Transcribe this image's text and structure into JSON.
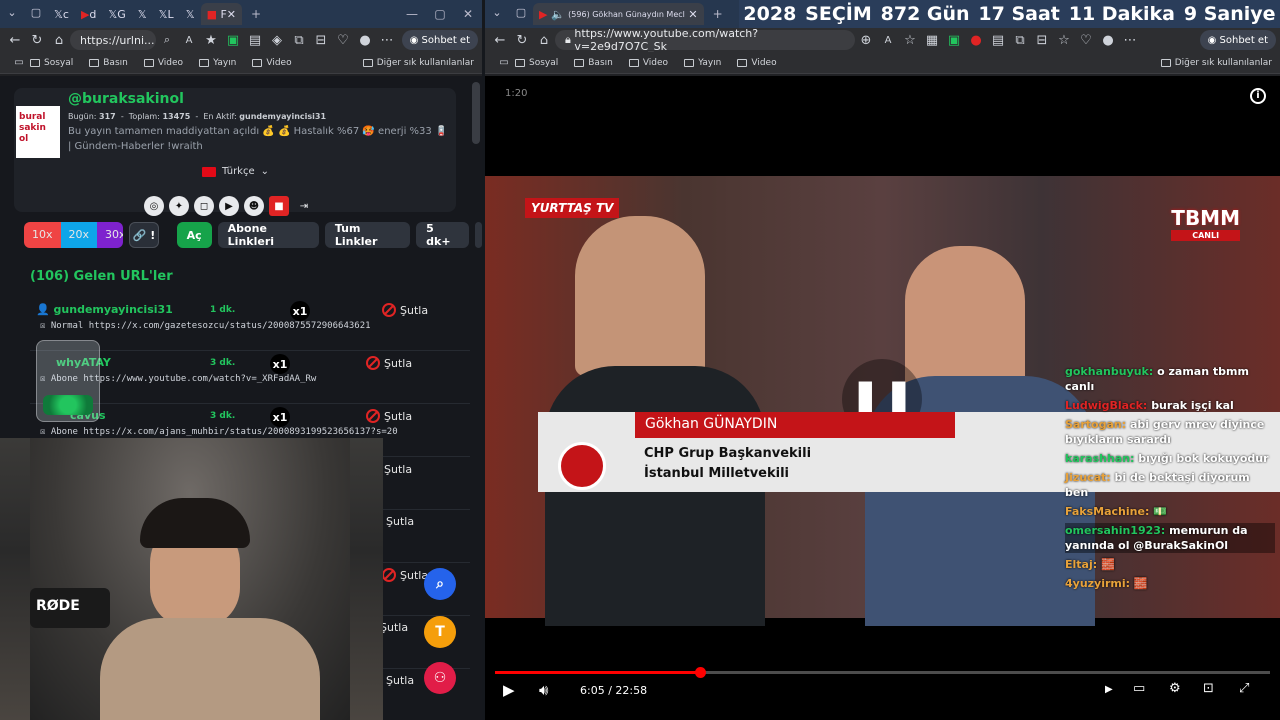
{
  "left_window": {
    "tabs": [
      "c",
      "d",
      "G",
      "L",
      "F"
    ],
    "url": "https://urlni...",
    "sobhet": "Sohbet et",
    "bookmarks": [
      "Sosyal",
      "Basın",
      "Video",
      "Yayın",
      "Video"
    ],
    "other_bookmarks": "Diğer sık kullanılanlar",
    "profile": {
      "username": "@buraksakinol",
      "logo_text": "bural sakin ol",
      "stats_bugun_label": "Bugün:",
      "stats_bugun": "317",
      "stats_toplam_label": "Toplam:",
      "stats_toplam": "13475",
      "stats_aktif_label": "En Aktif:",
      "stats_aktif": "gundemyayincisi31",
      "description": "Bu yayın tamamen maddiyattan açıldı 💰 💰 Hastalık %67 🥵 enerji %33 🪫 | Gündem-Haberler !wraith",
      "language": "Türkçe"
    },
    "buttons": {
      "b10x": "10x",
      "b20x": "20x",
      "b30x": "30x",
      "link": "🔗 !",
      "ac": "Aç",
      "abone": "Abone Linkleri",
      "tum": "Tum Linkler",
      "dk5": "5 dk+"
    },
    "list_title": "(106) Gelen URL'ler",
    "rows": [
      {
        "user": "gundemyayincisi31",
        "time": "1 dk.",
        "count": "x1",
        "action": "Şutla",
        "link": "Normal https://x.com/gazetesozcu/status/2000875572906643621"
      },
      {
        "user": "whyATAY",
        "time": "3 dk.",
        "count": "x1",
        "action": "Şutla",
        "link": "Abone https://www.youtube.com/watch?v=_XRFadAA_Rw"
      },
      {
        "user": "cavus",
        "time": "3 dk.",
        "count": "x1",
        "action": "Şutla",
        "link": "Abone https://x.com/ajans_muhbir/status/2000893199523656137?s=20"
      },
      {
        "user": "",
        "time": "",
        "count": "",
        "action": "Şutla",
        "link": ""
      },
      {
        "user": "",
        "time": "",
        "count": "",
        "action": "Şutla",
        "link": ""
      },
      {
        "user": "",
        "time": "",
        "count": "",
        "action": "Şutla",
        "link": ""
      },
      {
        "user": "",
        "time": "",
        "count": "",
        "action": "Şutla",
        "link": ""
      },
      {
        "user": "",
        "time": "",
        "count": "",
        "action": "Şutla",
        "link": ""
      }
    ],
    "fab_t": "T"
  },
  "right_window": {
    "tab_title": "(596) Gökhan Günaydın Mecl",
    "url": "https://www.youtube.com/watch?v=2e9d7O7C_Sk",
    "sobhet": "Sohbet et",
    "bookmarks": [
      "Sosyal",
      "Basın",
      "Video",
      "Yayın",
      "Video"
    ],
    "other_bookmarks": "Diğer sık kullanılanlar",
    "countdown": [
      "2028",
      "SEÇİM",
      "872 Gün",
      "17 Saat",
      "11 Dakika",
      "9 Saniye"
    ],
    "video": {
      "corner_time": "1:20",
      "channel_logo": "YURTTAŞ TV",
      "tbmm": "TBMM",
      "tbmm_sub": "CANLI",
      "lower_name": "Gökhan GÜNAYDIN",
      "lower_title1": "CHP Grup Başkanvekili",
      "lower_title2": "İstanbul Milletvekili",
      "time": "6:05 / 22:58",
      "progress": 0.265
    },
    "chat": [
      {
        "user": "gokhanbuyuk:",
        "msg": "o zaman tbmm canlı",
        "color": "#22c55e"
      },
      {
        "user": "LudwigBlack:",
        "msg": "burak işçi kal",
        "color": "#e02424"
      },
      {
        "user": "Sartogan:",
        "msg": "abi gerv mrev diyince bıyıkların sarardı",
        "color": "#e8a23a"
      },
      {
        "user": "karashhan:",
        "msg": "bıyığı bok kokuyodur",
        "color": "#22c55e"
      },
      {
        "user": "Jizucat:",
        "msg": "bi de bektaşi diyorum ben",
        "color": "#e8a23a"
      },
      {
        "user": "FaksMachine:",
        "msg": "💵",
        "color": "#e8a23a"
      },
      {
        "user": "omersahin1923:",
        "msg": "memurun da yanında ol @BurakSakinOl",
        "color": "#22c55e"
      },
      {
        "user": "Eltaj:",
        "msg": "🧱",
        "color": "#e8a23a"
      },
      {
        "user": "4yuzyirmi:",
        "msg": "🧱",
        "color": "#e8a23a"
      }
    ]
  }
}
